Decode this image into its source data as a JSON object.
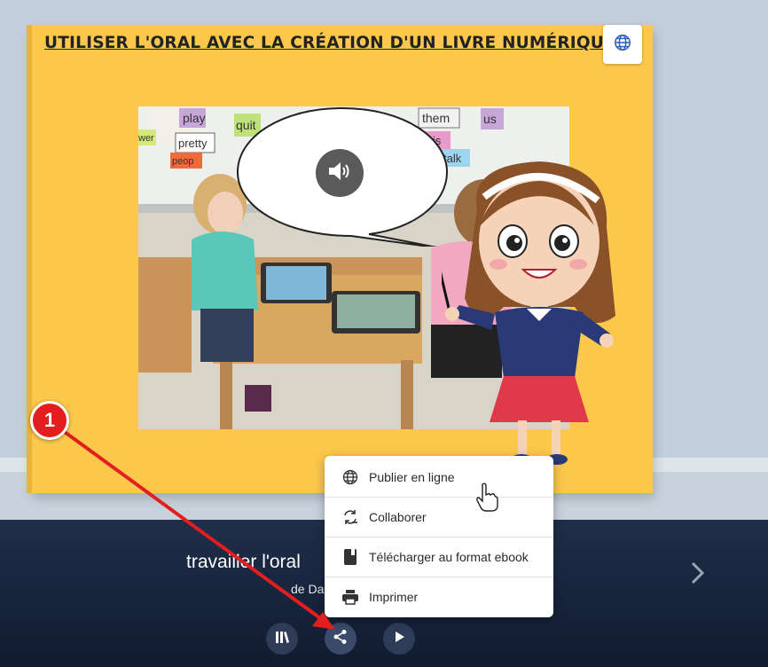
{
  "book": {
    "title": "UTILISER L'ORAL AVEC LA CRÉATION D'UN LIVRE NUMÉRIQUE",
    "photo_words": [
      "play",
      "quit",
      "them",
      "us",
      "pretty",
      "this",
      "talk",
      "wer",
      "peop"
    ]
  },
  "share_menu": {
    "items": [
      {
        "label": "Publier en ligne",
        "icon": "globe-icon"
      },
      {
        "label": "Collaborer",
        "icon": "collaborate-icon"
      },
      {
        "label": "Télécharger au format ebook",
        "icon": "ebook-icon"
      },
      {
        "label": "Imprimer",
        "icon": "printer-icon"
      }
    ]
  },
  "footer": {
    "book_name": "travailler l'oral",
    "author": "de Da"
  },
  "annotation": {
    "badge": "1",
    "color": "#e31e1e"
  },
  "colors": {
    "cover": "#fbc84b",
    "bottom_bar": "#1a2740",
    "accent_red": "#e31e1e"
  }
}
